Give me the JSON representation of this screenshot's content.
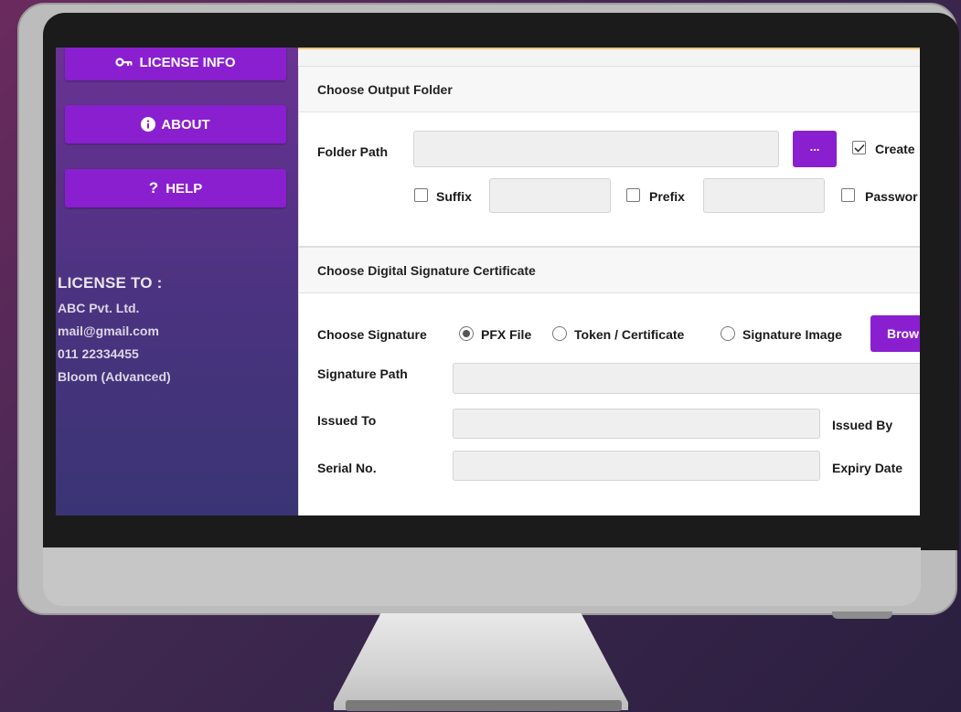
{
  "sidebar": {
    "license_info_label": "LICENSE INFO",
    "about_label": "ABOUT",
    "help_label": "HELP",
    "help_glyph": "?",
    "license_to_title": "LICENSE TO :",
    "license_lines": [
      "ABC Pvt. Ltd.",
      "mail@gmail.com",
      "011 22334455",
      "Bloom (Advanced)"
    ]
  },
  "output_folder": {
    "header": "Choose Output Folder",
    "folder_path_label": "Folder Path",
    "folder_path_value": "",
    "browse_dots_label": "...",
    "create_label": "Create",
    "create_checked": true,
    "suffix_label": "Suffix",
    "suffix_value": "",
    "prefix_label": "Prefix",
    "prefix_value": "",
    "password_label": "Passwor"
  },
  "signature": {
    "header": "Choose Digital Signature Certificate",
    "choose_signature_label": "Choose Signature",
    "options": [
      "PFX File",
      "Token / Certificate",
      "Signature Image"
    ],
    "selected_option": "PFX File",
    "browse_label": "Brow",
    "signature_path_label": "Signature Path",
    "issued_to_label": "Issued To",
    "issued_by_label": "Issued By",
    "serial_no_label": "Serial No.",
    "expiry_date_label": "Expiry Date"
  },
  "colors": {
    "accent": "#8a1fd0",
    "sidebar_top": "#6b3294",
    "sidebar_bottom": "#3a3474"
  }
}
